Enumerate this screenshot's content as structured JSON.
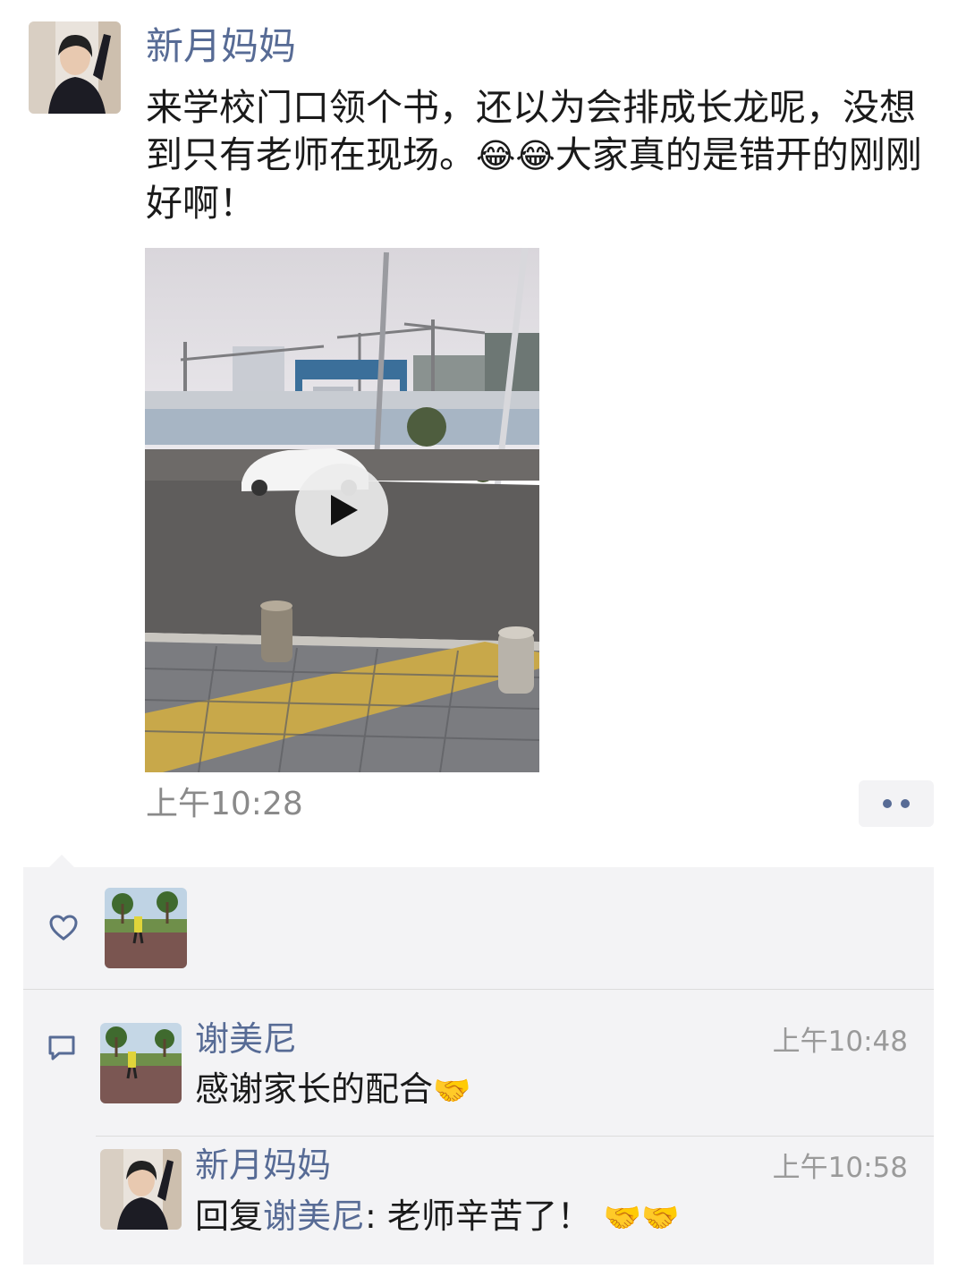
{
  "post": {
    "author": "新月妈妈",
    "text_main": "来学校门口领个书，还以为会排成长龙呢，没想到只有老师在现场。",
    "emoji": "😂😂",
    "text_tail": "大家真的是错开的刚刚好啊！",
    "time": "上午10:28"
  },
  "likes": {
    "icon": "heart-icon"
  },
  "comments": [
    {
      "name": "谢美尼",
      "time": "上午10:48",
      "text": "感谢家长的配合",
      "emoji": "🤝"
    },
    {
      "name": "新月妈妈",
      "time": "上午10:58",
      "reply_prefix": "回复",
      "reply_to": "谢美尼",
      "text": ": 老师辛苦了！",
      "emoji": "🤝🤝"
    }
  ],
  "colors": {
    "link": "#576b95",
    "panel_bg": "#f3f3f5",
    "timestamp": "#8a8a8a"
  }
}
